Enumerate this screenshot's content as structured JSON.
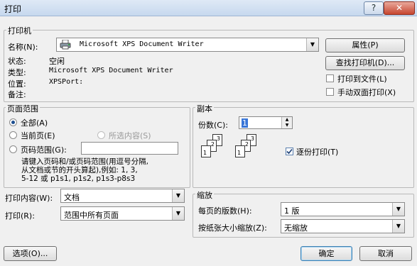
{
  "window": {
    "title": "打印",
    "help_label": "?",
    "close_label": "✕"
  },
  "printer": {
    "group_label": "打印机",
    "name_label": "名称(N):",
    "name_value": "Microsoft XPS Document Writer",
    "status_label": "状态:",
    "status_value": "空闲",
    "type_label": "类型:",
    "type_value": "Microsoft XPS Document Writer",
    "where_label": "位置:",
    "where_value": "XPSPort:",
    "comment_label": "备注:",
    "properties_button": "属性(P)",
    "find_button": "查找打印机(D)...",
    "print_to_file": "打印到文件(L)",
    "manual_duplex": "手动双面打印(X)"
  },
  "page_range": {
    "group_label": "页面范围",
    "all": "全部(A)",
    "current": "当前页(E)",
    "selection": "所选内容(S)",
    "pages": "页码范围(G):",
    "hint_line1": "请键入页码和/或页码范围(用逗号分隔,",
    "hint_line2": "从文档或节的开头算起),例如: 1, 3,",
    "hint_line3": "5-12 或 p1s1, p1s2, p1s3-p8s3"
  },
  "copies": {
    "group_label": "副本",
    "count_label": "份数(C):",
    "count_value": "1",
    "collate": "逐份打印(T)",
    "page_digits": [
      "1",
      "2",
      "3"
    ]
  },
  "print_what": {
    "label": "打印内容(W):",
    "value": "文档"
  },
  "print": {
    "label": "打印(R):",
    "value": "范围中所有页面"
  },
  "zoom": {
    "group_label": "缩放",
    "pages_per_sheet_label": "每页的版数(H):",
    "pages_per_sheet_value": "1 版",
    "scale_label": "按纸张大小缩放(Z):",
    "scale_value": "无缩放"
  },
  "footer": {
    "options": "选项(O)...",
    "ok": "确定",
    "cancel": "取消"
  },
  "icons": {
    "printer": "printer-icon",
    "dropdown": "▼",
    "spin_up": "▲",
    "spin_down": "▼"
  }
}
